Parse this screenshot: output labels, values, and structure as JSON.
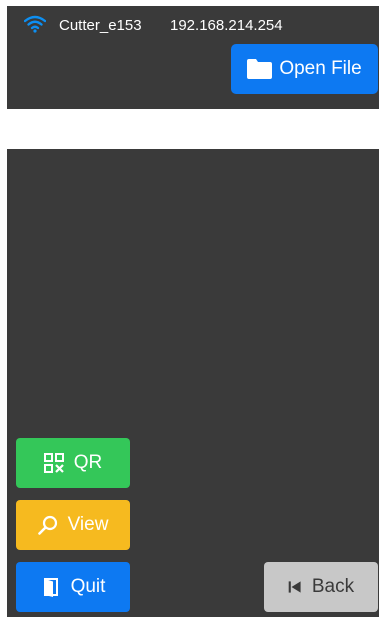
{
  "status": {
    "device_name": "Cutter_e153",
    "ip_address": "192.168.214.254",
    "wifi_icon": "wifi-icon"
  },
  "toolbar": {
    "open_file_label": "Open File",
    "open_file_icon": "folder-icon"
  },
  "path_bar": {
    "value": ""
  },
  "side_buttons": {
    "qr_label": "QR",
    "view_label": "View",
    "quit_label": "Quit"
  },
  "back_button": {
    "label": "Back"
  },
  "colors": {
    "background": "#3a3a3a",
    "primary_blue": "#0d79f2",
    "qr_green": "#34c759",
    "view_yellow": "#f6ba1f",
    "back_gray": "#c8c8c8",
    "wifi_blue": "#0d8ff2"
  }
}
